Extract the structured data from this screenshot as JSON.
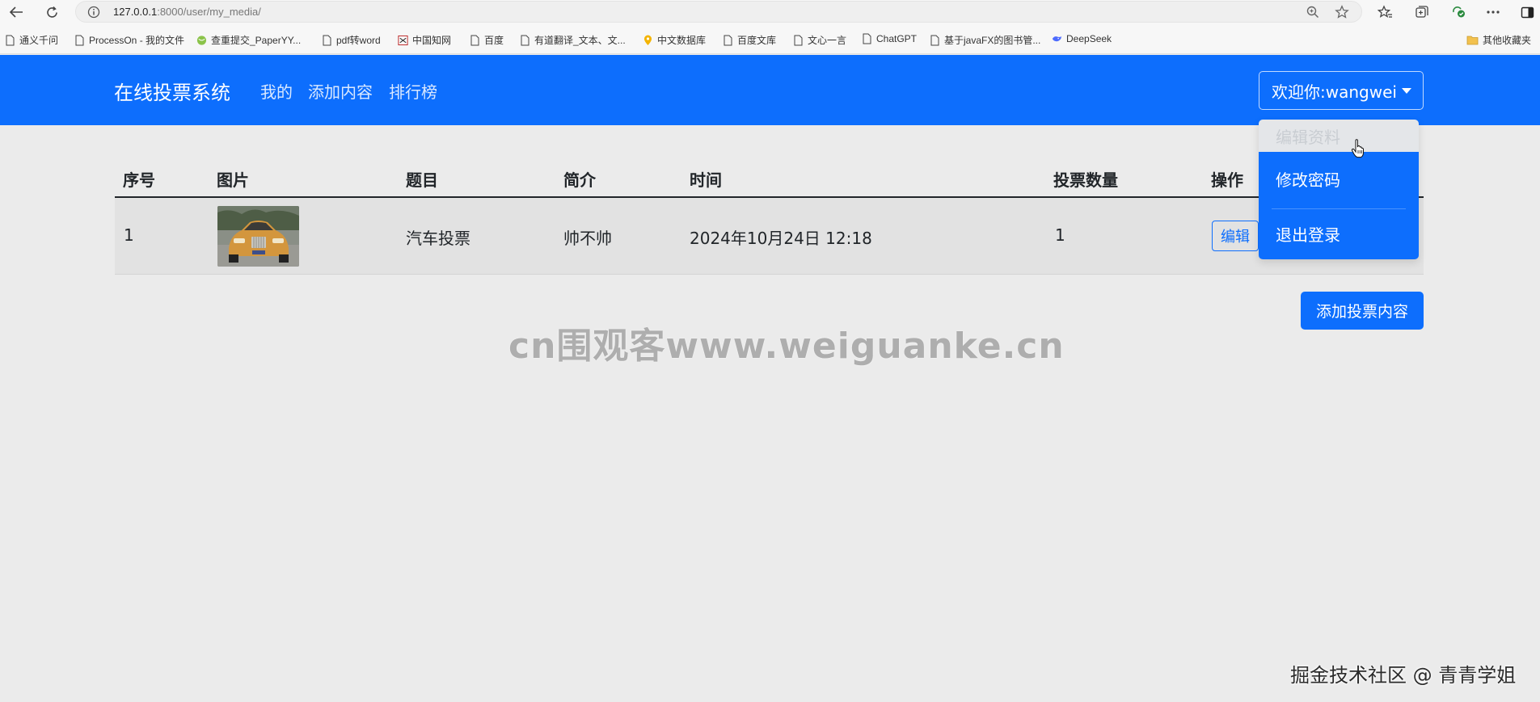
{
  "browser": {
    "url_host": "127.0.0.1",
    "url_path": ":8000/user/my_media/",
    "bookmarks": [
      {
        "label": "通义千问",
        "icon": "page-icon"
      },
      {
        "label": "ProcessOn - 我的文件",
        "icon": "page-icon"
      },
      {
        "label": "查重提交_PaperYY...",
        "icon": "globe-icon"
      },
      {
        "label": "pdf转word",
        "icon": "page-icon"
      },
      {
        "label": "中国知网",
        "icon": "cnki-icon"
      },
      {
        "label": "百度",
        "icon": "page-icon"
      },
      {
        "label": "有道翻译_文本、文...",
        "icon": "page-icon"
      },
      {
        "label": "中文数据库",
        "icon": "location-icon"
      },
      {
        "label": "百度文库",
        "icon": "page-icon"
      },
      {
        "label": "文心一言",
        "icon": "page-icon"
      },
      {
        "label": "ChatGPT",
        "icon": "page-icon"
      },
      {
        "label": "基于javaFX的图书管...",
        "icon": "page-icon"
      },
      {
        "label": "DeepSeek",
        "icon": "deepseek-icon"
      }
    ],
    "other_bookmarks": "其他收藏夹"
  },
  "navbar": {
    "brand": "在线投票系统",
    "links": [
      "我的",
      "添加内容",
      "排行榜"
    ],
    "user_button": "欢迎你:wangwei",
    "accent_color": "#0d6efd"
  },
  "dropdown": {
    "items": [
      "编辑资料",
      "修改密码",
      "退出登录"
    ],
    "hovered_index": 0
  },
  "table": {
    "headers": [
      "序号",
      "图片",
      "题目",
      "简介",
      "时间",
      "投票数量",
      "操作"
    ],
    "rows": [
      {
        "index": "1",
        "image": "car-photo",
        "title": "汽车投票",
        "intro": "帅不帅",
        "time": "2024年10月24日 12:18",
        "votes": "1",
        "action": "编辑"
      }
    ]
  },
  "add_button": "添加投票内容",
  "watermarks": {
    "center": "cn围观客www.weiguanke.cn",
    "corner": "掘金技术社区 @ 青青学姐"
  }
}
